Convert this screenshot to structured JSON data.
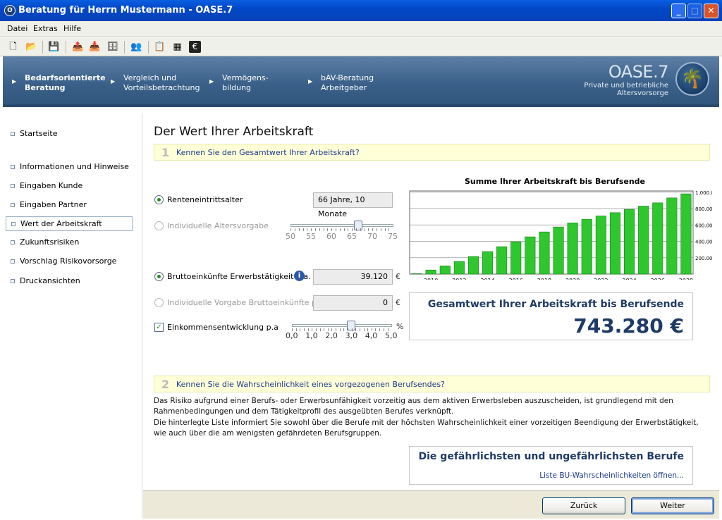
{
  "window": {
    "title": "Beratung für Herrn Mustermann - OASE.7",
    "app_icon": "oase-icon"
  },
  "menu": [
    "Datei",
    "Extras",
    "Hilfe"
  ],
  "toolbar_icons": [
    "new-document-icon",
    "open-folder-icon",
    "save-icon",
    "export-icon",
    "import-icon",
    "archive-icon",
    "users-icon",
    "clipboard-icon",
    "calculator-icon",
    "euro-icon"
  ],
  "nav": {
    "items": [
      {
        "label": "Bedarfsorientierte\nBeratung",
        "active": true
      },
      {
        "label": "Vergleich und\nVorteilsbetrachtung",
        "active": false
      },
      {
        "label": "Vermögens-\nbildung",
        "active": false
      },
      {
        "label": "bAV-Beratung\nArbeitgeber",
        "active": false
      }
    ],
    "brand_title": "OASE.7",
    "brand_sub1": "Private und betriebliche",
    "brand_sub2": "Altersvorsorge"
  },
  "sidebar": {
    "items": [
      {
        "label": "Startseite"
      },
      {
        "label": "Informationen und Hinweise"
      },
      {
        "label": "Eingaben Kunde"
      },
      {
        "label": "Eingaben Partner"
      },
      {
        "label": "Wert der Arbeitskraft"
      },
      {
        "label": "Zukunftsrisiken"
      },
      {
        "label": "Vorschlag Risikovorsorge"
      },
      {
        "label": "Druckansichten"
      }
    ]
  },
  "main": {
    "title": "Der Wert Ihrer Arbeitskraft",
    "q1": {
      "num": "1",
      "text": "Kennen Sie den Gesamtwert Ihrer Arbeitskraft?"
    },
    "rente_label": "Renteneintrittsalter",
    "rente_value": "66 Jahre, 10 Monate",
    "alter_label": "Individuelle Altersvorgabe",
    "alter_ticks": [
      "50",
      "55",
      "60",
      "65",
      "70",
      "75"
    ],
    "alter_slider_value": 66.83,
    "brutto_label": "Bruttoeinkünfte Erwerbstätigkeit p.a.",
    "brutto_value": "39.120",
    "brutto_unit": "€",
    "indiv_brutto_label": "Individuelle Vorgabe Bruttoeinkünfte p.a.",
    "indiv_brutto_value": "0",
    "indiv_brutto_unit": "€",
    "einkommen_label": "Einkommensentwicklung p.a",
    "einkommen_unit": "%",
    "einkommen_ticks": [
      "0,0",
      "1,0",
      "2,0",
      "3,0",
      "4,0",
      "5,0"
    ],
    "einkommen_slider_value": 3.0,
    "result_title": "Gesamtwert Ihrer Arbeitskraft bis Berufsende",
    "result_value": "743.280 €",
    "q2": {
      "num": "2",
      "text": "Kennen Sie die Wahrscheinlichkeit eines vorgezogenen Berufsendes?"
    },
    "para1": "Das Risiko aufgrund einer Berufs- oder Erwerbsunfähigkeit vorzeitig aus dem aktiven Erwerbsleben auszuscheiden, ist grundlegend mit den Rahmenbedingungen und dem Tätigkeitprofil des ausgeübten Berufes verknüpft.",
    "para2": "Die hinterlegte Liste  informiert Sie sowohl über die Berufe mit der höchsten Wahrscheinlichkeit einer vorzeitigen Beendigung der Erwerbstätigkeit, wie auch über die am wenigsten gefährdeten Berufsgruppen.",
    "risk_title": "Die gefährlichsten und ungefährlichsten Berufe",
    "risk_link": "Liste BU-Wahrscheinlichkeiten öffnen..."
  },
  "chart_data": {
    "type": "bar",
    "title": "Summe Ihrer Arbeitskraft bis Berufsende",
    "x": [
      2009,
      2010,
      2011,
      2012,
      2013,
      2014,
      2015,
      2016,
      2017,
      2018,
      2019,
      2020,
      2021,
      2022,
      2023,
      2024,
      2025,
      2026,
      2027,
      2028
    ],
    "values": [
      5000,
      50000,
      100000,
      155000,
      215000,
      275000,
      335000,
      395000,
      455000,
      515000,
      575000,
      625000,
      670000,
      710000,
      750000,
      790000,
      830000,
      870000,
      930000,
      980000
    ],
    "x_tick_labels": [
      "2010",
      "2012",
      "2014",
      "2016",
      "2018",
      "2020",
      "2022",
      "2024",
      "2026",
      "2028"
    ],
    "y_tick_labels": [
      "200.000",
      "400.000",
      "600.000",
      "800.000",
      "1.000.000"
    ],
    "ylim": [
      0,
      1000000
    ],
    "grid": true,
    "bar_color": "#2ec82e"
  },
  "footer": {
    "back": "Zurück",
    "next": "Weiter"
  }
}
